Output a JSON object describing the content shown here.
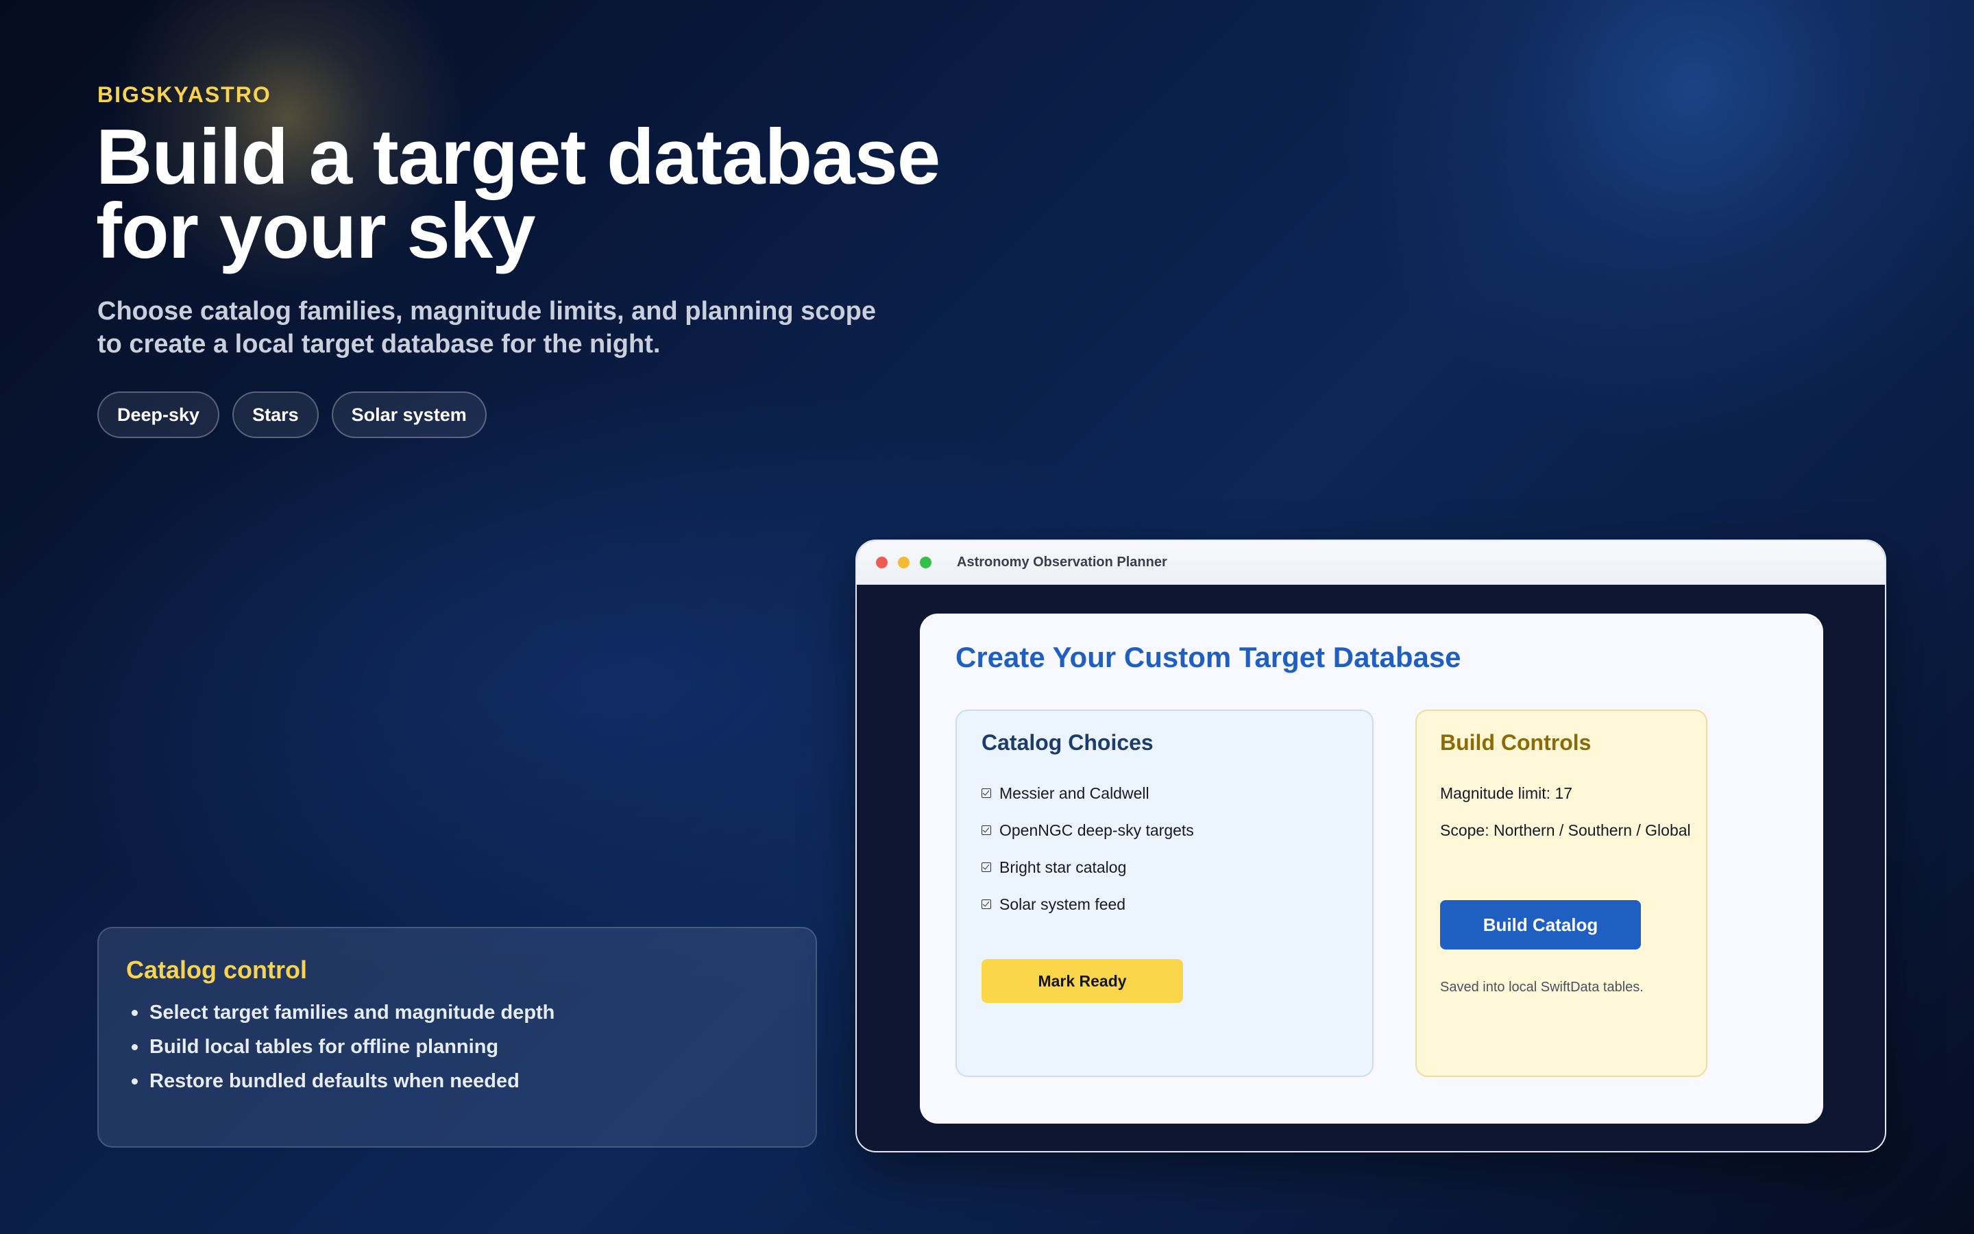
{
  "hero": {
    "brand": "BIGSKYASTRO",
    "headline_line1": "Build a target database",
    "headline_line2": "for your sky",
    "subhead_line1": "Choose catalog families, magnitude limits, and planning scope",
    "subhead_line2": "to create a local target database for the night.",
    "chips": [
      "Deep-sky",
      "Stars",
      "Solar system"
    ]
  },
  "info_card": {
    "title": "Catalog control",
    "items": [
      "Select target families and magnitude depth",
      "Build local tables for offline planning",
      "Restore bundled defaults when needed"
    ]
  },
  "window": {
    "title": "Astronomy Observation Planner",
    "panel_title": "Create Your Custom Target Database",
    "choices": {
      "title": "Catalog Choices",
      "items": [
        "Messier and Caldwell",
        "OpenNGC deep-sky targets",
        "Bright star catalog",
        "Solar system feed"
      ],
      "button": "Mark Ready"
    },
    "controls": {
      "title": "Build Controls",
      "magnitude": "Magnitude limit: 17",
      "scope": "Scope: Northern / Southern / Global",
      "button": "Build Catalog",
      "note": "Saved into local SwiftData tables."
    }
  },
  "colors": {
    "accent_yellow": "#f8d34e",
    "accent_blue": "#1f5fc2",
    "traffic_red": "#ef5b52",
    "traffic_yellow": "#f5b935",
    "traffic_green": "#32c145"
  }
}
